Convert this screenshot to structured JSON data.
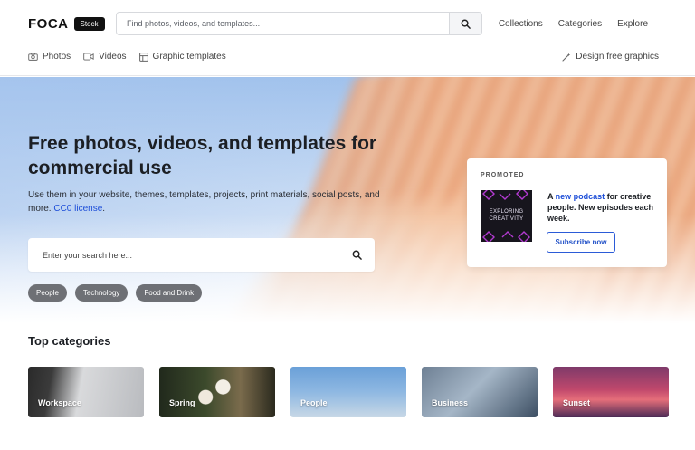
{
  "header": {
    "brand_name": "FOCA",
    "brand_badge": "Stock",
    "search_placeholder": "Find photos, videos, and templates...",
    "nav": [
      "Collections",
      "Categories",
      "Explore"
    ],
    "sub_nav": [
      {
        "label": "Photos",
        "icon": "camera-icon"
      },
      {
        "label": "Videos",
        "icon": "video-icon"
      },
      {
        "label": "Graphic templates",
        "icon": "template-icon"
      }
    ],
    "design_link": "Design free graphics"
  },
  "hero": {
    "title": "Free photos, videos, and templates for commercial use",
    "desc_prefix": "Use them in your website, themes, templates, projects, print materials, social posts, and more. ",
    "desc_link": "CC0 license",
    "desc_suffix": ".",
    "search_placeholder": "Enter your search here...",
    "tags": [
      "People",
      "Technology",
      "Food and Drink"
    ]
  },
  "promo": {
    "label": "PROMOTED",
    "cover_text": "EXPLORING CREATIVITY",
    "text_prefix": "A ",
    "text_link": "new podcast",
    "text_suffix": " for creative people. New episodes each week.",
    "button": "Subscribe now"
  },
  "categories": {
    "title": "Top categories",
    "items": [
      "Workspace",
      "Spring",
      "People",
      "Business",
      "Sunset"
    ]
  },
  "colors": {
    "accent": "#1d4ed8",
    "tag_bg": "#6e7075",
    "brand_badge_bg": "#111111"
  }
}
